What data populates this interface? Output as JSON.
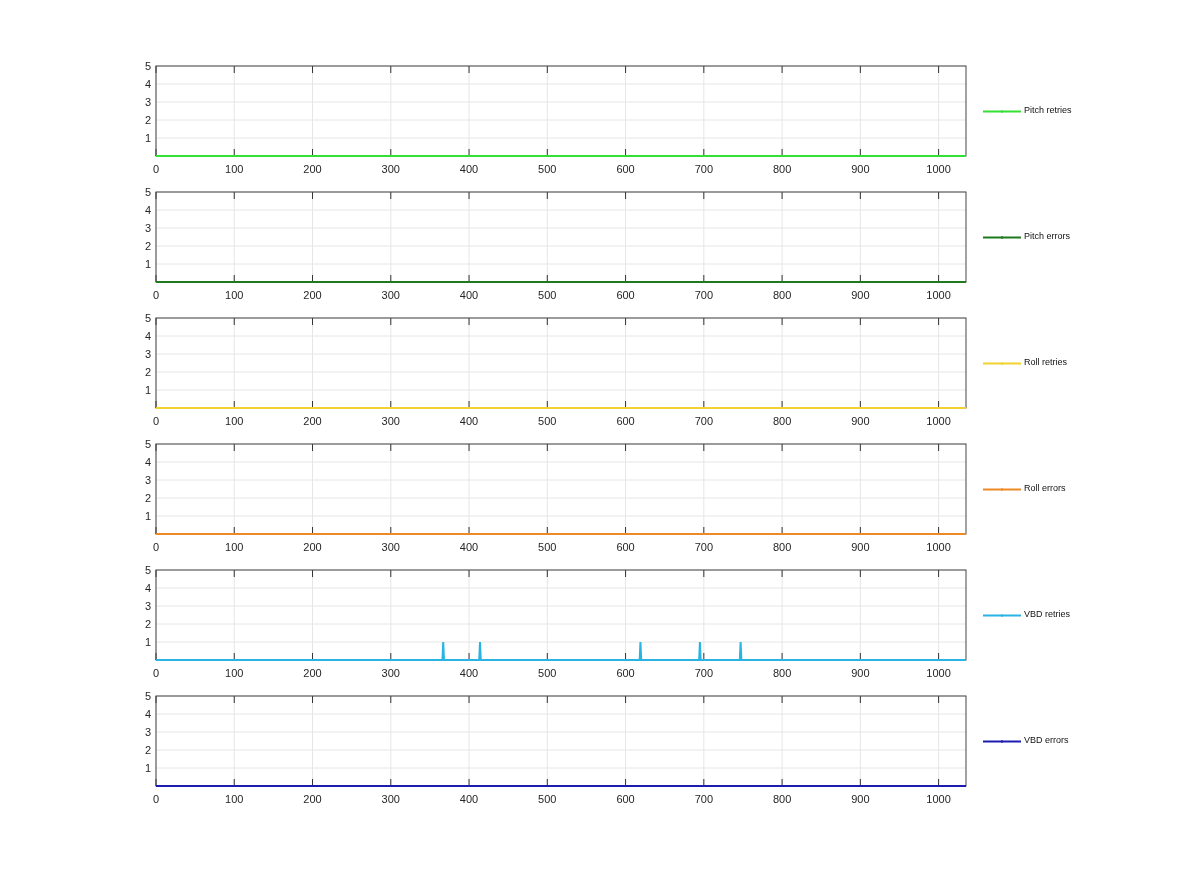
{
  "charts": [
    {
      "chart_data": {
        "type": "line",
        "grid": true,
        "x": [
          0,
          1035
        ],
        "series": [
          {
            "name": "Pitch retries",
            "color": "#33e033",
            "values": [
              0,
              0
            ]
          }
        ],
        "xlim": [
          0,
          1035
        ],
        "ylim": [
          0,
          5
        ],
        "xticks": [
          0,
          100,
          200,
          300,
          400,
          500,
          600,
          700,
          800,
          900,
          1000
        ],
        "yticks": [
          1,
          2,
          3,
          4,
          5
        ]
      }
    },
    {
      "chart_data": {
        "type": "line",
        "grid": true,
        "x": [
          0,
          1035
        ],
        "series": [
          {
            "name": "Pitch errors",
            "color": "#1f7a1f",
            "values": [
              0,
              0
            ]
          }
        ],
        "xlim": [
          0,
          1035
        ],
        "ylim": [
          0,
          5
        ],
        "xticks": [
          0,
          100,
          200,
          300,
          400,
          500,
          600,
          700,
          800,
          900,
          1000
        ],
        "yticks": [
          1,
          2,
          3,
          4,
          5
        ]
      }
    },
    {
      "chart_data": {
        "type": "line",
        "grid": true,
        "x": [
          0,
          1035
        ],
        "series": [
          {
            "name": "Roll retries",
            "color": "#f2d22e",
            "values": [
              0,
              0
            ]
          }
        ],
        "xlim": [
          0,
          1035
        ],
        "ylim": [
          0,
          5
        ],
        "xticks": [
          0,
          100,
          200,
          300,
          400,
          500,
          600,
          700,
          800,
          900,
          1000
        ],
        "yticks": [
          1,
          2,
          3,
          4,
          5
        ]
      }
    },
    {
      "chart_data": {
        "type": "line",
        "grid": true,
        "x": [
          0,
          1035
        ],
        "series": [
          {
            "name": "Roll errors",
            "color": "#ee8a26",
            "values": [
              0,
              0
            ]
          }
        ],
        "xlim": [
          0,
          1035
        ],
        "ylim": [
          0,
          5
        ],
        "xticks": [
          0,
          100,
          200,
          300,
          400,
          500,
          600,
          700,
          800,
          900,
          1000
        ],
        "yticks": [
          1,
          2,
          3,
          4,
          5
        ]
      }
    },
    {
      "chart_data": {
        "type": "line",
        "grid": true,
        "x": [
          0,
          366,
          367,
          368,
          413,
          414,
          415,
          618,
          619,
          620,
          694,
          695,
          696,
          746,
          747,
          748,
          1035
        ],
        "series": [
          {
            "name": "VBD retries",
            "color": "#2ab4e4",
            "values": [
              0,
              0,
              1,
              0,
              0,
              1,
              0,
              0,
              1,
              0,
              0,
              1,
              0,
              0,
              1,
              0,
              0
            ]
          }
        ],
        "xlim": [
          0,
          1035
        ],
        "ylim": [
          0,
          5
        ],
        "xticks": [
          0,
          100,
          200,
          300,
          400,
          500,
          600,
          700,
          800,
          900,
          1000
        ],
        "yticks": [
          1,
          2,
          3,
          4,
          5
        ]
      }
    },
    {
      "chart_data": {
        "type": "line",
        "grid": true,
        "x": [
          0,
          1035
        ],
        "series": [
          {
            "name": "VBD errors",
            "color": "#1c1cb0",
            "values": [
              0,
              0
            ]
          }
        ],
        "xlim": [
          0,
          1035
        ],
        "ylim": [
          0,
          5
        ],
        "xticks": [
          0,
          100,
          200,
          300,
          400,
          500,
          600,
          700,
          800,
          900,
          1000
        ],
        "yticks": [
          1,
          2,
          3,
          4,
          5
        ]
      }
    }
  ]
}
